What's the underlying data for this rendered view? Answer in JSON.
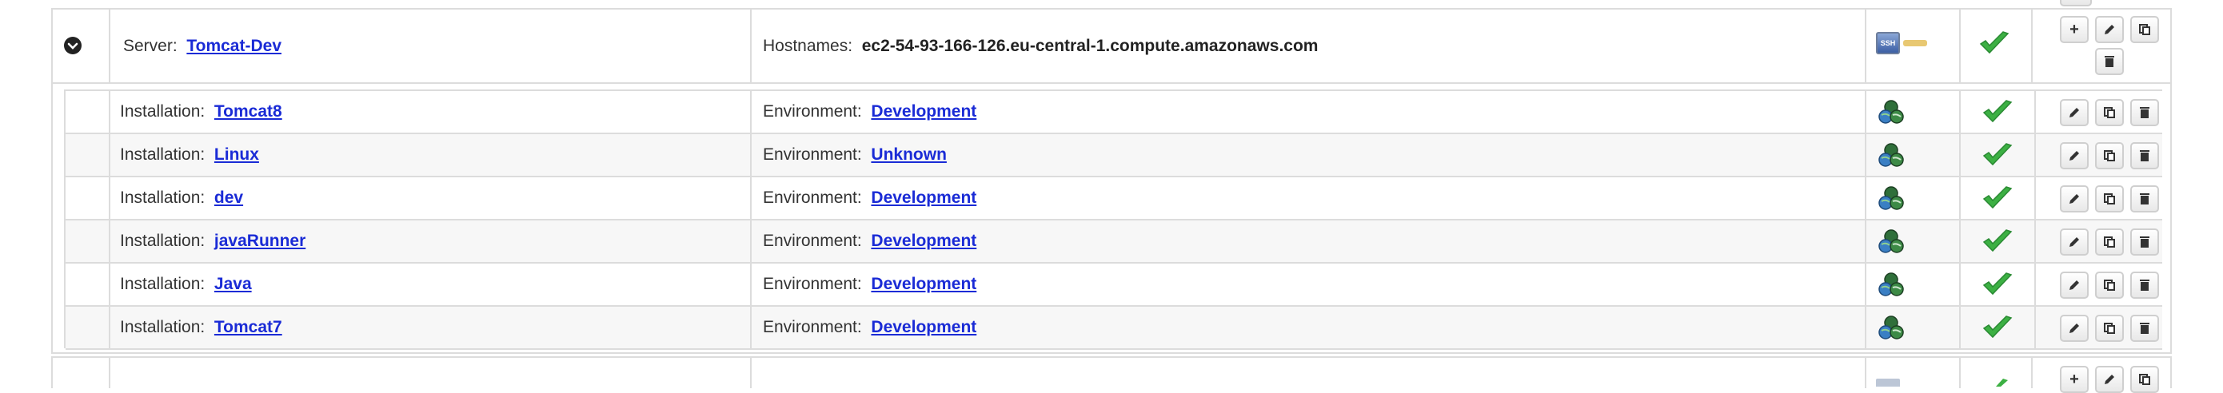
{
  "server": {
    "label": "Server:",
    "name": "Tomcat-Dev",
    "hostnames_label": "Hostnames:",
    "hostnames_value": "ec2-54-93-166-126.eu-central-1.compute.amazonaws.com",
    "ssh_badge": "SSH",
    "toggle_icon": "chevron-down-circle-icon",
    "status_icon": "green-check-icon"
  },
  "installation_label": "Installation:",
  "environment_label": "Environment:",
  "installations": [
    {
      "name": "Tomcat8",
      "environment": "Development"
    },
    {
      "name": "Linux",
      "environment": "Unknown"
    },
    {
      "name": "dev",
      "environment": "Development"
    },
    {
      "name": "javaRunner",
      "environment": "Development"
    },
    {
      "name": "Java",
      "environment": "Development"
    },
    {
      "name": "Tomcat7",
      "environment": "Development"
    }
  ],
  "actions": {
    "add": "+",
    "edit_icon": "pencil-icon",
    "copy_icon": "copy-icon",
    "delete_icon": "trash-icon"
  },
  "colors": {
    "link": "#1a2bd6",
    "check": "#3cb043",
    "border": "#dcdcdc",
    "row_alt": "#f7f7f7"
  }
}
